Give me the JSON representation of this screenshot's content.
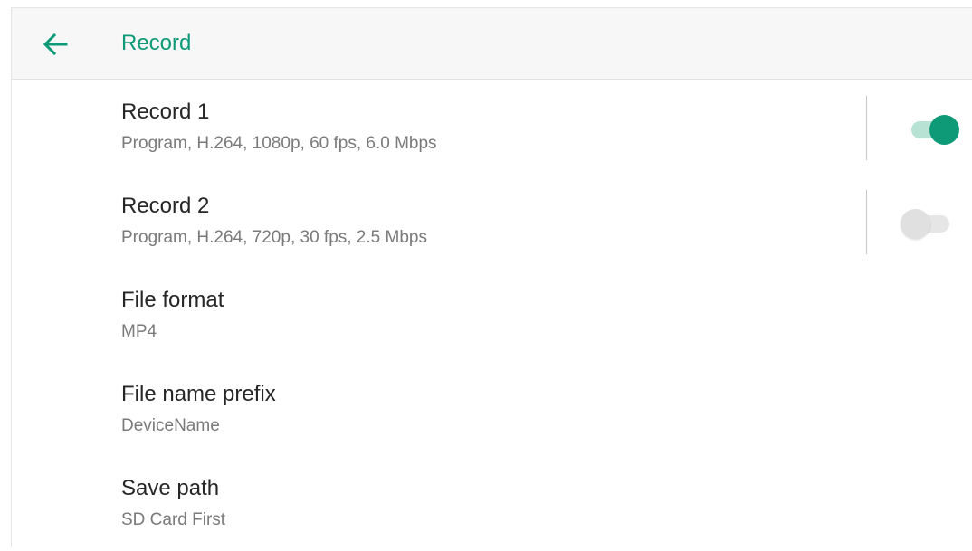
{
  "colors": {
    "accent": "#0e9a77",
    "accent_light": "#b7e2d4",
    "title_text": "#262626",
    "subtitle_text": "#7a7a7a"
  },
  "appbar": {
    "back_icon": "arrow-left-icon",
    "title": "Record"
  },
  "items": [
    {
      "title": "Record 1",
      "subtitle": "Program, H.264, 1080p, 60 fps, 6.0 Mbps",
      "toggle": true
    },
    {
      "title": "Record 2",
      "subtitle": "Program, H.264, 720p, 30 fps, 2.5 Mbps",
      "toggle": false
    },
    {
      "title": "File format",
      "subtitle": "MP4"
    },
    {
      "title": "File name prefix",
      "subtitle": "DeviceName"
    },
    {
      "title": "Save path",
      "subtitle": "SD Card First"
    }
  ]
}
